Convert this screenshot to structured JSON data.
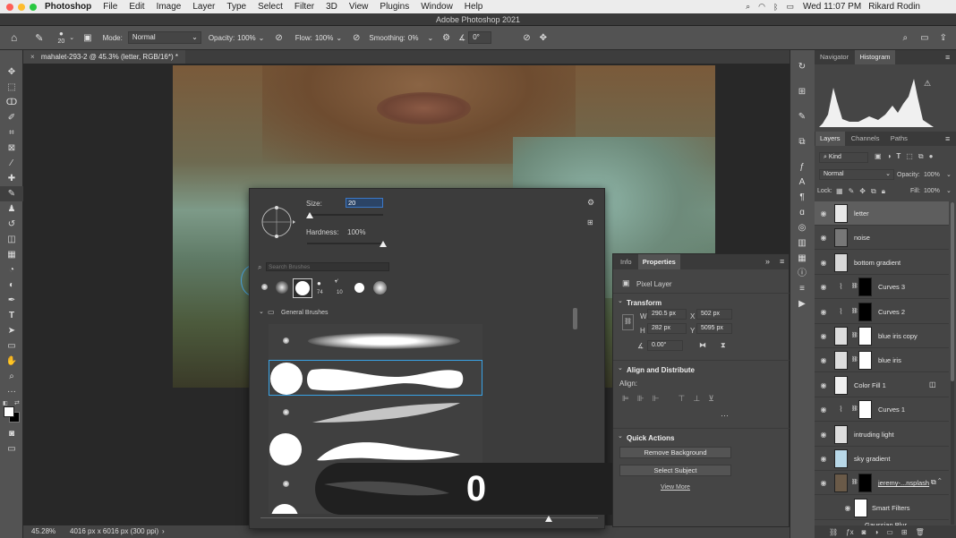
{
  "menubar": {
    "app_name": "Photoshop",
    "menus": [
      "File",
      "Edit",
      "Image",
      "Layer",
      "Type",
      "Select",
      "Filter",
      "3D",
      "View",
      "Plugins",
      "Window",
      "Help"
    ],
    "clock": "Wed 11:07 PM",
    "user": "Rikard Rodin"
  },
  "window": {
    "title": "Adobe Photoshop 2021"
  },
  "options_bar": {
    "brush_size": "20",
    "mode_label": "Mode:",
    "mode_value": "Normal",
    "opacity_label": "Opacity:",
    "opacity_value": "100%",
    "flow_label": "Flow:",
    "flow_value": "100%",
    "smoothing_label": "Smoothing:",
    "smoothing_value": "0%",
    "angle_value": "0°"
  },
  "document": {
    "tab_title": "mahalet-293-2 @ 45.3% (letter, RGB/16*) *",
    "zoom": "45.28%",
    "dimensions": "4016 px x 6016 px (300 ppi)"
  },
  "brush_panel": {
    "size_label": "Size:",
    "size_value": "20",
    "size_slider_fraction": 0.03,
    "hardness_label": "Hardness:",
    "hardness_value": "100%",
    "hardness_slider_fraction": 1.0,
    "search_placeholder": "Search Brushes",
    "recent_counts": [
      "74",
      "10"
    ],
    "group_name": "General Brushes"
  },
  "overlay_value": "0",
  "properties_panel": {
    "tabs": [
      "Info",
      "Properties"
    ],
    "active_tab": "Properties",
    "kind": "Pixel Layer",
    "transform_title": "Transform",
    "w_label": "W",
    "w_value": "290.5 px",
    "h_label": "H",
    "h_value": "282 px",
    "x_label": "X",
    "x_value": "502 px",
    "y_label": "Y",
    "y_value": "5095 px",
    "angle_value": "0.00°",
    "align_title": "Align and Distribute",
    "align_label": "Align:",
    "quick_title": "Quick Actions",
    "remove_bg": "Remove Background",
    "select_subject": "Select Subject",
    "view_more": "View More"
  },
  "navigator": {
    "tabs": [
      "Navigator",
      "Histogram"
    ],
    "active_tab": "Histogram"
  },
  "layers_panel": {
    "tabs": [
      "Layers",
      "Channels",
      "Paths"
    ],
    "active_tab": "Layers",
    "filter_kind": "Kind",
    "blend_mode": "Normal",
    "opacity_label": "Opacity:",
    "opacity_value": "100%",
    "lock_label": "Lock:",
    "fill_label": "Fill:",
    "fill_value": "100%",
    "layers": [
      {
        "name": "letter",
        "selected": true,
        "adjust": false,
        "mask": false,
        "thumb": "#e8e8e8"
      },
      {
        "name": "noise",
        "selected": false,
        "adjust": false,
        "mask": false,
        "thumb": "#777777"
      },
      {
        "name": "bottom gradient",
        "selected": false,
        "adjust": false,
        "mask": false,
        "thumb": "#d8d8d8"
      },
      {
        "name": "Curves 3",
        "selected": false,
        "adjust": true,
        "mask": true,
        "mask_color": "#000000"
      },
      {
        "name": "Curves 2",
        "selected": false,
        "adjust": true,
        "mask": true,
        "mask_color": "#000000"
      },
      {
        "name": "blue iris copy",
        "selected": false,
        "adjust": false,
        "mask": true,
        "thumb": "#dddddd",
        "mask_color": "#ffffff"
      },
      {
        "name": "blue iris",
        "selected": false,
        "adjust": false,
        "mask": true,
        "thumb": "#dddddd",
        "mask_color": "#ffffff"
      },
      {
        "name": "Color Fill 1",
        "selected": false,
        "adjust": false,
        "mask": false,
        "thumb": "#f0f0f0"
      },
      {
        "name": "Curves 1",
        "selected": false,
        "adjust": true,
        "mask": true,
        "mask_color": "#ffffff"
      },
      {
        "name": "intruding light",
        "selected": false,
        "adjust": false,
        "mask": false,
        "thumb": "#dddddd"
      },
      {
        "name": "sky gradient",
        "selected": false,
        "adjust": false,
        "mask": false,
        "thumb": "#b8d8e8"
      },
      {
        "name": "jeremy-...nsplash",
        "selected": false,
        "adjust": false,
        "mask": true,
        "thumb": "#6a5a48",
        "mask_color": "#000000"
      }
    ],
    "smart_filters_label": "Smart Filters",
    "partial_label": "Gaussian Blur"
  }
}
